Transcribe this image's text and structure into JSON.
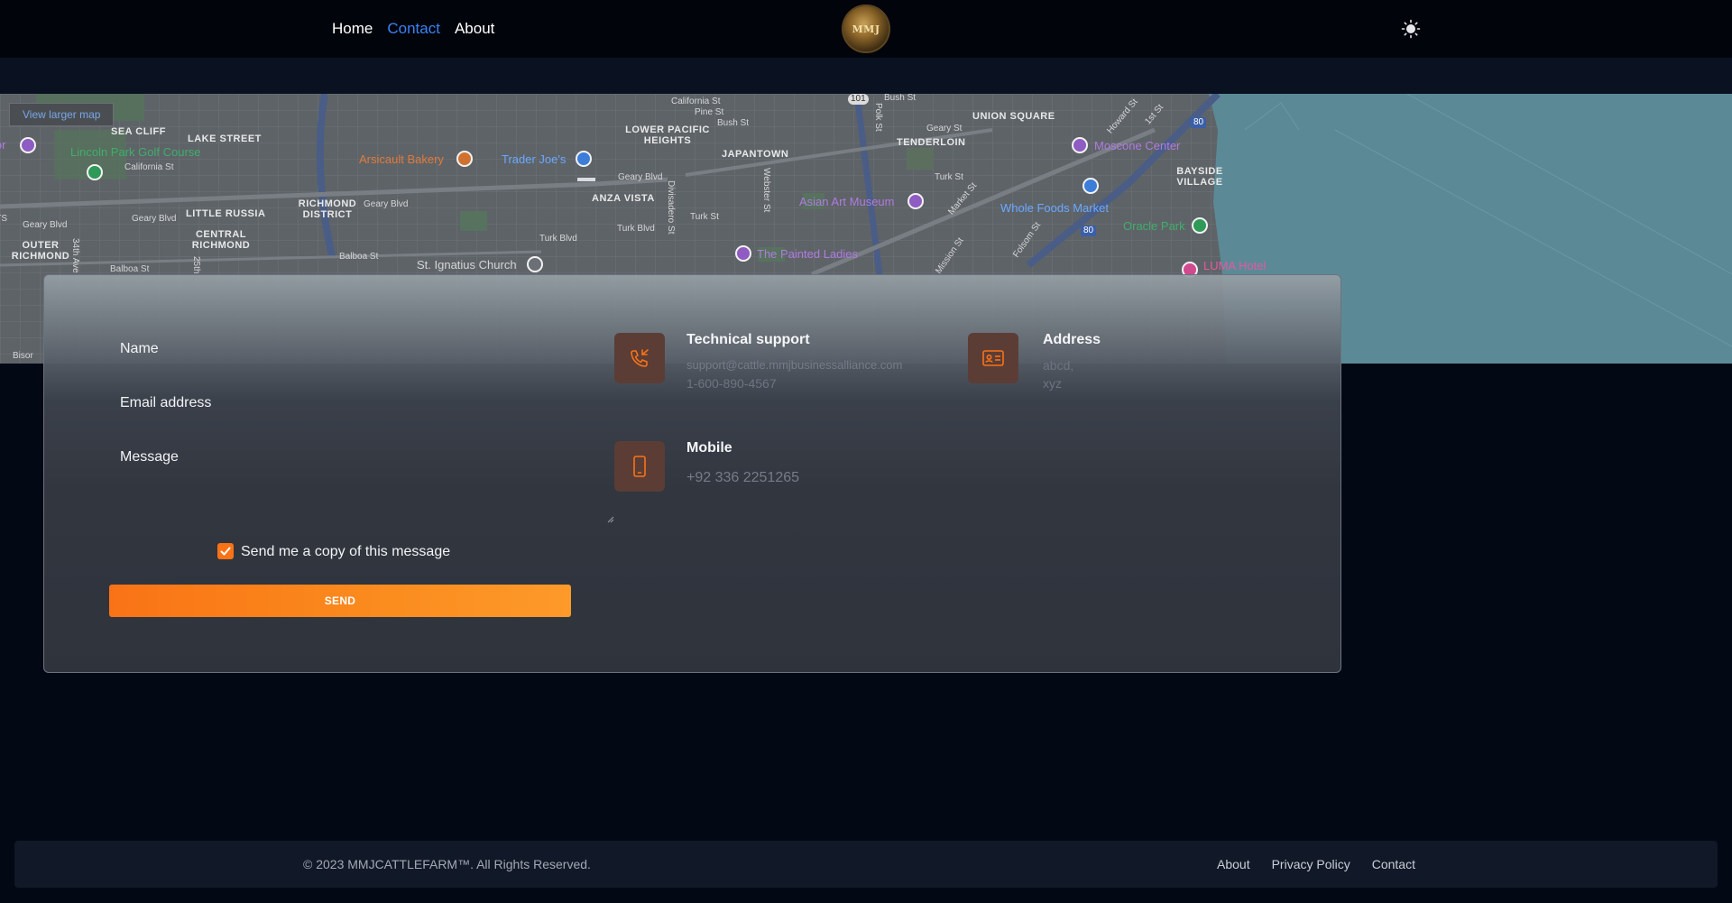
{
  "nav": {
    "links": [
      {
        "label": "Home",
        "active": false
      },
      {
        "label": "Contact",
        "active": true
      },
      {
        "label": "About",
        "active": false
      }
    ],
    "logo_text": "MMJ",
    "theme_icon": "sun-icon",
    "active_color": "#3b82f6"
  },
  "map": {
    "larger_map_link": "View larger map",
    "labels": {
      "sea_cliff": "SEA CLIFF",
      "lake_street": "LAKE STREET",
      "lincoln_park": "Lincoln Park Golf Course",
      "california_st_w": "California St",
      "little_russia": "LITTLE RUSSIA",
      "richmond_district": "RICHMOND DISTRICT",
      "central_richmond": "CENTRAL RICHMOND",
      "outer_richmond": "OUTER RICHMOND",
      "geary_blvd_w": "Geary Blvd",
      "geary_blvd_w2": "Geary Blvd",
      "geary_blvd_c": "Geary Blvd",
      "geary_blvd_e": "Geary Blvd",
      "balboa_st": "Balboa St",
      "balboa_st_w": "Balboa St",
      "ave_34": "34th Ave",
      "ave_25": "25th",
      "arsicault": "Arsicault Bakery",
      "trader_joes": "Trader Joe's",
      "st_ignatius": "St. Ignatius Church",
      "california_st_c": "California St",
      "pine_st": "Pine St",
      "bush_st": "Bush St",
      "bush_st_e": "Bush St",
      "lower_pacific_heights": "LOWER PACIFIC HEIGHTS",
      "japantown": "JAPANTOWN",
      "anza_vista": "ANZA VISTA",
      "turk_blvd": "Turk Blvd",
      "turk_blvd_2": "Turk Blvd",
      "turk_st": "Turk St",
      "turk_st_e": "Turk St",
      "divisadero": "Divisadero St",
      "webster": "Webster St",
      "polk": "Polk St",
      "painted_ladies": "The Painted Ladies",
      "asian_art": "Asian Art Museum",
      "union_square": "UNION SQUARE",
      "tenderloin": "TENDERLOIN",
      "geary_st": "Geary St",
      "market_st": "Market St",
      "mission_st": "Mission St",
      "folsom_st": "Folsom St",
      "howard_st": "Howard St",
      "ist_st": "1st St",
      "moscone": "Moscone Center",
      "whole_foods": "Whole Foods Market",
      "oracle_park": "Oracle Park",
      "bayside_village": "BAYSIDE VILLAGE",
      "luma": "LUMA Hotel",
      "hwy_101": "101",
      "hwy_80": "80",
      "hwy_80b": "80",
      "bison": "Bisor",
      "ts": "NTS",
      "museum_w": "ior"
    }
  },
  "form": {
    "name_label": "Name",
    "email_label": "Email address",
    "message_label": "Message",
    "checkbox_label": "Send me a copy of this message",
    "checkbox_checked": true,
    "send_label": "SEND",
    "accent": "#f97316"
  },
  "info": {
    "technical_support": {
      "title": "Technical support",
      "email": "support@cattle.mmjbusinessalliance.com",
      "phone": "1-600-890-4567",
      "icon": "phone-call-icon"
    },
    "address": {
      "title": "Address",
      "line1": "abcd,",
      "line2": "xyz",
      "icon": "address-card-icon"
    },
    "mobile": {
      "title": "Mobile",
      "number": "+92 336 2251265",
      "icon": "mobile-phone-icon"
    }
  },
  "footer": {
    "copyright": "© 2023 MMJCATTLEFARM™. All Rights Reserved.",
    "links": [
      "About",
      "Privacy Policy",
      "Contact"
    ]
  }
}
